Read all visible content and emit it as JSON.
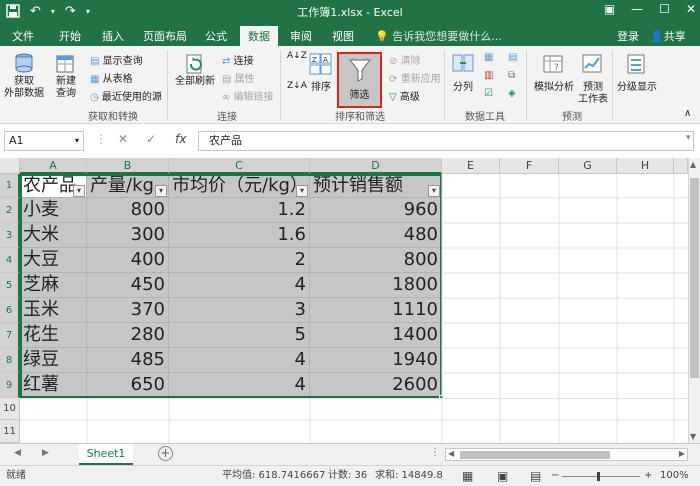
{
  "window": {
    "title": "工作簿1.xlsx - Excel"
  },
  "tabs": [
    "文件",
    "开始",
    "插入",
    "页面布局",
    "公式",
    "数据",
    "审阅",
    "视图"
  ],
  "tell_me": "告诉我您想要做什么...",
  "login": "登录",
  "share": "共享",
  "ribbon": {
    "get_external": "获取\n外部数据",
    "new_query": "新建\n查询",
    "show_queries": "显示查询",
    "from_table": "从表格",
    "recent_sources": "最近使用的源",
    "group_get_transform": "获取和转换",
    "refresh_all": "全部刷新",
    "connections": "连接",
    "properties": "属性",
    "edit_links": "编辑链接",
    "group_connections": "连接",
    "sort_az": "A↓Z",
    "sort_za": "Z↓A",
    "sort": "排序",
    "filter": "筛选",
    "clear": "清除",
    "reapply": "重新应用",
    "advanced": "高级",
    "group_sort_filter": "排序和筛选",
    "split": "分列",
    "group_data_tools": "数据工具",
    "what_if": "模拟分析",
    "forecast_sheet": "预测\n工作表",
    "group_forecast": "预测",
    "outline": "分级显示"
  },
  "formula_bar": {
    "cell_ref": "A1",
    "cancel": "✕",
    "enter": "✓",
    "fx": "fx",
    "content": "农产品"
  },
  "columns": [
    "A",
    "B",
    "C",
    "D",
    "E",
    "F",
    "G",
    "H"
  ],
  "rows": [
    "1",
    "2",
    "3",
    "4",
    "5",
    "6",
    "7",
    "8",
    "9",
    "10",
    "11"
  ],
  "table": {
    "headers": [
      "农产品",
      "产量/kg",
      "市均价（元/kg）",
      "预计销售额"
    ],
    "rows": [
      [
        "小麦",
        "800",
        "1.2",
        "960"
      ],
      [
        "大米",
        "300",
        "1.6",
        "480"
      ],
      [
        "大豆",
        "400",
        "2",
        "800"
      ],
      [
        "芝麻",
        "450",
        "4",
        "1800"
      ],
      [
        "玉米",
        "370",
        "3",
        "1110"
      ],
      [
        "花生",
        "280",
        "5",
        "1400"
      ],
      [
        "绿豆",
        "485",
        "4",
        "1940"
      ],
      [
        "红薯",
        "650",
        "4",
        "2600"
      ]
    ]
  },
  "sheet_tab": "Sheet1",
  "status": {
    "ready": "就绪",
    "average": "平均值: 618.7416667",
    "count": "计数: 36",
    "sum": "求和: 14849.8",
    "zoom": "100%"
  },
  "colors": {
    "excel_green": "#217346",
    "selection_gray": "#c6c6c6",
    "highlight_red": "#e02020"
  }
}
